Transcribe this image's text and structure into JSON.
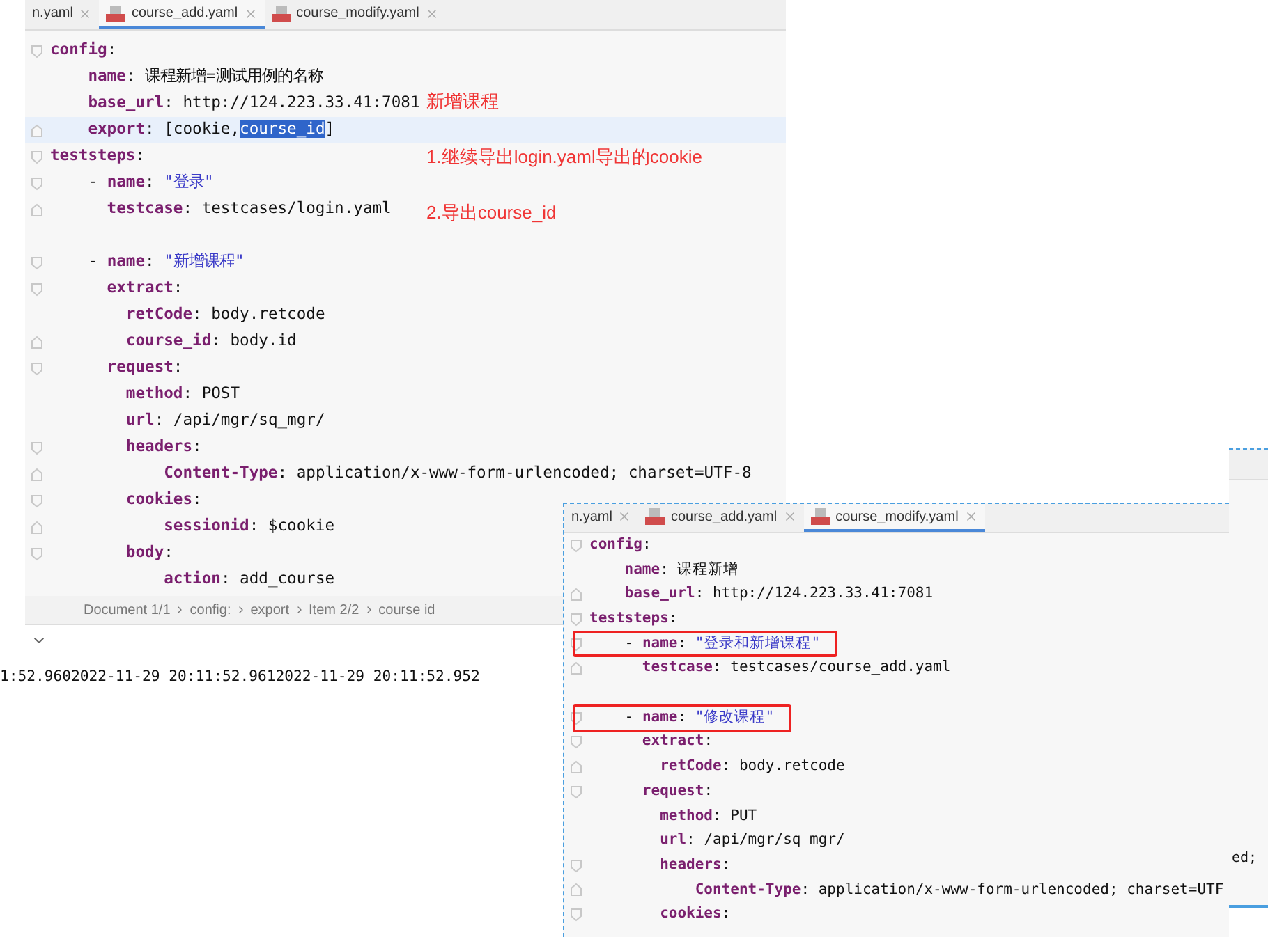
{
  "main_editor": {
    "tabs": [
      {
        "label": "n.yaml",
        "selected": false
      },
      {
        "label": "course_add.yaml",
        "selected": true
      },
      {
        "label": "course_modify.yaml",
        "selected": false
      }
    ],
    "lines": [
      {
        "segs": [
          {
            "t": "config",
            "kind": "key"
          },
          {
            "t": ":",
            "kind": "plain"
          }
        ],
        "fold_open": true
      },
      {
        "segs": [
          {
            "t": "    name",
            "kind": "key"
          },
          {
            "t": ": 课程新增=测试用例的名称",
            "kind": "plain"
          }
        ]
      },
      {
        "segs": [
          {
            "t": "    base_url",
            "kind": "key"
          },
          {
            "t": ": http://124.223.33.41:7081",
            "kind": "plain"
          }
        ]
      },
      {
        "segs": [
          {
            "t": "    export",
            "kind": "key"
          },
          {
            "t": ": [cookie,",
            "kind": "plain"
          },
          {
            "t": "course_id",
            "kind": "selection"
          },
          {
            "t": "]",
            "kind": "plain"
          }
        ],
        "fold_close": true,
        "current": true
      },
      {
        "segs": [
          {
            "t": "teststeps",
            "kind": "key"
          },
          {
            "t": ":",
            "kind": "plain"
          }
        ],
        "fold_open": true
      },
      {
        "segs": [
          {
            "t": "    - ",
            "kind": "plain"
          },
          {
            "t": "name",
            "kind": "key"
          },
          {
            "t": ": ",
            "kind": "plain"
          },
          {
            "t": "\"登录\"",
            "kind": "string"
          }
        ],
        "fold_open": true
      },
      {
        "segs": [
          {
            "t": "      testcase",
            "kind": "key"
          },
          {
            "t": ": testcases/login.yaml",
            "kind": "plain"
          }
        ],
        "fold_close": true
      },
      {
        "blank": true
      },
      {
        "segs": [
          {
            "t": "    - ",
            "kind": "plain"
          },
          {
            "t": "name",
            "kind": "key"
          },
          {
            "t": ": ",
            "kind": "plain"
          },
          {
            "t": "\"新增课程\"",
            "kind": "string"
          }
        ],
        "fold_open": true
      },
      {
        "segs": [
          {
            "t": "      extract",
            "kind": "key"
          },
          {
            "t": ":",
            "kind": "plain"
          }
        ],
        "fold_open": true
      },
      {
        "segs": [
          {
            "t": "        retCode",
            "kind": "key"
          },
          {
            "t": ": body.retcode",
            "kind": "plain"
          }
        ]
      },
      {
        "segs": [
          {
            "t": "        course_id",
            "kind": "key"
          },
          {
            "t": ": body.id",
            "kind": "plain"
          }
        ],
        "fold_close": true
      },
      {
        "segs": [
          {
            "t": "      request",
            "kind": "key"
          },
          {
            "t": ":",
            "kind": "plain"
          }
        ],
        "fold_open": true
      },
      {
        "segs": [
          {
            "t": "        method",
            "kind": "key"
          },
          {
            "t": ": POST",
            "kind": "plain"
          }
        ]
      },
      {
        "segs": [
          {
            "t": "        url",
            "kind": "key"
          },
          {
            "t": ": /api/mgr/sq_mgr/",
            "kind": "plain"
          }
        ]
      },
      {
        "segs": [
          {
            "t": "        headers",
            "kind": "key"
          },
          {
            "t": ":",
            "kind": "plain"
          }
        ],
        "fold_open": true
      },
      {
        "segs": [
          {
            "t": "            Content-Type",
            "kind": "key"
          },
          {
            "t": ": application/x-www-form-urlencoded; charset=UTF-8",
            "kind": "plain"
          }
        ],
        "fold_close": true
      },
      {
        "segs": [
          {
            "t": "        cookies",
            "kind": "key"
          },
          {
            "t": ":",
            "kind": "plain"
          }
        ],
        "fold_open": true
      },
      {
        "segs": [
          {
            "t": "            sessionid",
            "kind": "key"
          },
          {
            "t": ": $cookie",
            "kind": "plain"
          }
        ],
        "fold_close": true
      },
      {
        "segs": [
          {
            "t": "        body",
            "kind": "key"
          },
          {
            "t": ":",
            "kind": "plain"
          }
        ],
        "fold_open": true
      },
      {
        "segs": [
          {
            "t": "            action",
            "kind": "key"
          },
          {
            "t": ": add_course",
            "kind": "plain"
          }
        ]
      }
    ],
    "annotations": [
      "新增课程",
      "1.继续导出login.yaml导出的cookie",
      "2.导出course_id"
    ],
    "breadcrumb": [
      "Document 1/1",
      "config:",
      "export",
      "Item 2/2",
      "course id"
    ],
    "console_line": "1:52.9602022-11-29 20:11:52.9612022-11-29 20:11:52.952"
  },
  "overlay_editor": {
    "tabs": [
      {
        "label": "n.yaml",
        "selected": false
      },
      {
        "label": "course_add.yaml",
        "selected": false
      },
      {
        "label": "course_modify.yaml",
        "selected": true
      }
    ],
    "lines": [
      {
        "segs": [
          {
            "t": "config",
            "kind": "key"
          },
          {
            "t": ":",
            "kind": "plain"
          }
        ],
        "fold_open": true
      },
      {
        "segs": [
          {
            "t": "    name",
            "kind": "key"
          },
          {
            "t": ": 课程新增",
            "kind": "plain"
          }
        ]
      },
      {
        "segs": [
          {
            "t": "    base_url",
            "kind": "key"
          },
          {
            "t": ": http://124.223.33.41:7081",
            "kind": "plain"
          }
        ],
        "fold_close": true
      },
      {
        "segs": [
          {
            "t": "teststeps",
            "kind": "key"
          },
          {
            "t": ":",
            "kind": "plain"
          }
        ],
        "fold_open": true
      },
      {
        "segs": [
          {
            "t": "    - ",
            "kind": "plain"
          },
          {
            "t": "name",
            "kind": "key"
          },
          {
            "t": ": ",
            "kind": "plain"
          },
          {
            "t": "\"登录和新增课程\"",
            "kind": "string"
          }
        ],
        "fold_open": true,
        "boxed": true
      },
      {
        "segs": [
          {
            "t": "      testcase",
            "kind": "key"
          },
          {
            "t": ": testcases/course_add.yaml",
            "kind": "plain"
          }
        ],
        "fold_close": true
      },
      {
        "blank": true
      },
      {
        "segs": [
          {
            "t": "    - ",
            "kind": "plain"
          },
          {
            "t": "name",
            "kind": "key"
          },
          {
            "t": ": ",
            "kind": "plain"
          },
          {
            "t": "\"修改课程\"",
            "kind": "string"
          }
        ],
        "fold_open": true,
        "boxed": true
      },
      {
        "segs": [
          {
            "t": "      extract",
            "kind": "key"
          },
          {
            "t": ":",
            "kind": "plain"
          }
        ],
        "fold_open": true
      },
      {
        "segs": [
          {
            "t": "        retCode",
            "kind": "key"
          },
          {
            "t": ": body.retcode",
            "kind": "plain"
          }
        ],
        "fold_close": true
      },
      {
        "segs": [
          {
            "t": "      request",
            "kind": "key"
          },
          {
            "t": ":",
            "kind": "plain"
          }
        ],
        "fold_open": true
      },
      {
        "segs": [
          {
            "t": "        method",
            "kind": "key"
          },
          {
            "t": ": PUT",
            "kind": "plain"
          }
        ]
      },
      {
        "segs": [
          {
            "t": "        url",
            "kind": "key"
          },
          {
            "t": ": /api/mgr/sq_mgr/",
            "kind": "plain"
          }
        ]
      },
      {
        "segs": [
          {
            "t": "        headers",
            "kind": "key"
          },
          {
            "t": ":",
            "kind": "plain"
          }
        ],
        "fold_open": true
      },
      {
        "segs": [
          {
            "t": "            Content-Type",
            "kind": "key"
          },
          {
            "t": ": application/x-www-form-urlencoded; charset=UTF",
            "kind": "plain"
          }
        ],
        "fold_close": true
      },
      {
        "segs": [
          {
            "t": "        cookies",
            "kind": "key"
          },
          {
            "t": ":",
            "kind": "plain"
          }
        ],
        "fold_open": true
      }
    ]
  },
  "back_editor": {
    "text": "ed;"
  }
}
